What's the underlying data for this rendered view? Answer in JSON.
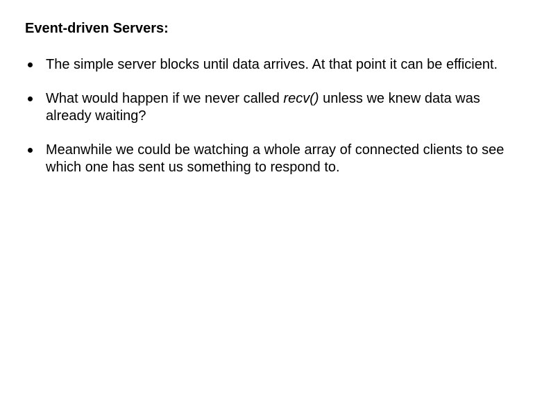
{
  "title": "Event-driven Servers:",
  "items": [
    {
      "text": "The simple server blocks until data arrives. At that point it can be efficient."
    },
    {
      "before": "What would happen if we never called ",
      "call": "recv()",
      "after": " unless we knew data was already waiting?"
    },
    {
      "text": "Meanwhile we could be watching a whole array of connected clients to see which one has sent us something to respond to."
    }
  ]
}
